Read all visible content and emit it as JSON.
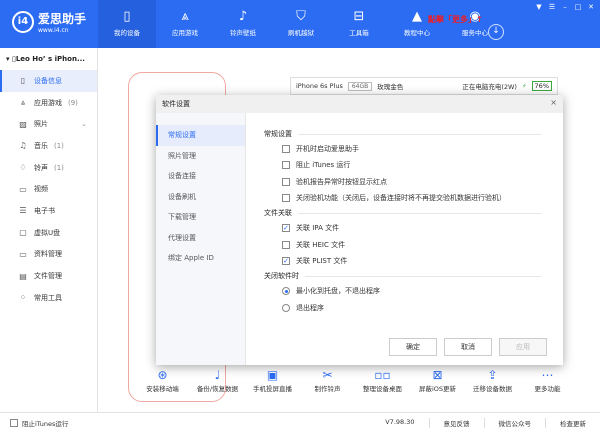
{
  "header": {
    "logo_mark": "i4",
    "logo_title": "爱思助手",
    "logo_url": "www.i4.cn",
    "promo": "點擊「更多」↑",
    "nav": [
      {
        "label": "我的设备",
        "icon": "phone-icon"
      },
      {
        "label": "应用游戏",
        "icon": "app-store-icon"
      },
      {
        "label": "铃声壁纸",
        "icon": "music-icon"
      },
      {
        "label": "刷机越狱",
        "icon": "shield-icon"
      },
      {
        "label": "工具箱",
        "icon": "toolbox-icon"
      },
      {
        "label": "教程中心",
        "icon": "graduation-cap-icon"
      },
      {
        "label": "服务中心",
        "icon": "compass-icon"
      }
    ]
  },
  "sidebar": {
    "device": "Leo Ho’ s iPhon...",
    "items": [
      {
        "label": "设备信息",
        "count": ""
      },
      {
        "label": "应用游戏",
        "count": "(9)"
      },
      {
        "label": "照片",
        "count": ""
      },
      {
        "label": "音乐",
        "count": "(1)"
      },
      {
        "label": "铃声",
        "count": "(1)"
      },
      {
        "label": "视频",
        "count": ""
      },
      {
        "label": "电子书",
        "count": ""
      },
      {
        "label": "虚拟U盘",
        "count": ""
      },
      {
        "label": "资料管理",
        "count": ""
      },
      {
        "label": "文件管理",
        "count": ""
      },
      {
        "label": "常用工具",
        "count": ""
      }
    ]
  },
  "device": {
    "model": "iPhone 6s Plus",
    "capacity": "64GB",
    "color": "玫瑰金色",
    "charging": "正在电脑充电(2W)",
    "battery": "76%"
  },
  "tools": [
    "安装移动端",
    "备份/恢复数据",
    "手机投屏直播",
    "制作铃声",
    "整理设备桌面",
    "屏蔽iOS更新",
    "迁移设备数据",
    "更多功能"
  ],
  "footer": {
    "block_itunes": "阻止iTunes运行",
    "version": "V7.98.30",
    "feedback": "意见反馈",
    "wechat": "微信公众号",
    "update": "检查更新"
  },
  "dialog": {
    "title": "软件设置",
    "close": "×",
    "nav": [
      "常规设置",
      "照片管理",
      "设备连接",
      "设备刷机",
      "下载管理",
      "代理设置",
      "绑定 Apple ID"
    ],
    "general_title": "常规设置",
    "general": [
      {
        "label": "开机时启动爱思助手",
        "checked": false
      },
      {
        "label": "阻止 iTunes 运行",
        "checked": false
      },
      {
        "label": "验机报告异常时按钮显示红点",
        "checked": false
      },
      {
        "label": "关闭验机功能（关闭后，设备连接时将不再提交验机数据进行验机）",
        "checked": false
      }
    ],
    "assoc_title": "文件关联",
    "assoc": [
      {
        "label": "关联 IPA 文件",
        "checked": true
      },
      {
        "label": "关联 HEIC 文件",
        "checked": false
      },
      {
        "label": "关联 PLIST 文件",
        "checked": true
      }
    ],
    "close_title": "关闭软件时",
    "close_opts": [
      {
        "label": "最小化到托盘，不退出程序",
        "selected": true
      },
      {
        "label": "退出程序",
        "selected": false
      }
    ],
    "ok": "确定",
    "cancel": "取消",
    "apply": "应用"
  }
}
